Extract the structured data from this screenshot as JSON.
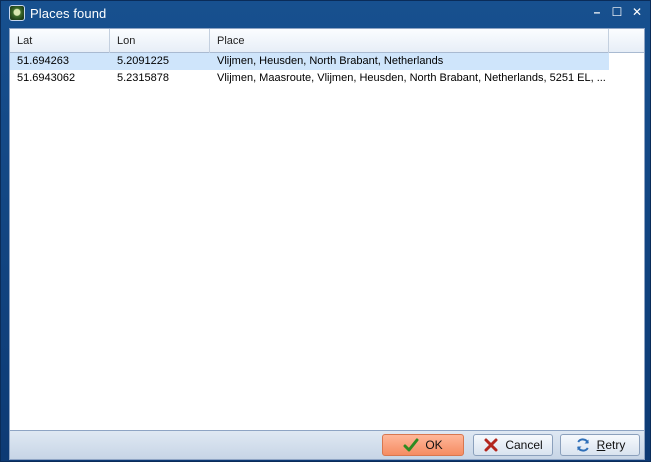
{
  "window": {
    "title": "Places found",
    "buttons": {
      "minimize": "–",
      "maximize": "☐",
      "close": "✕"
    }
  },
  "grid": {
    "columns": [
      "Lat",
      "Lon",
      "Place"
    ],
    "rows": [
      {
        "lat": "51.694263",
        "lon": "5.2091225",
        "place": "Vlijmen, Heusden, North Brabant, Netherlands",
        "selected": true
      },
      {
        "lat": "51.6943062",
        "lon": "5.2315878",
        "place": "Vlijmen, Maasroute, Vlijmen, Heusden, North Brabant, Netherlands, 5251 EL, ..."
      }
    ]
  },
  "footer": {
    "ok_label": "OK",
    "cancel_label": "Cancel",
    "retry_label": "Retry"
  },
  "colors": {
    "title_bar": "#17508f",
    "selected_row": "#cfe5fb",
    "ok_button": "#f58c62"
  }
}
